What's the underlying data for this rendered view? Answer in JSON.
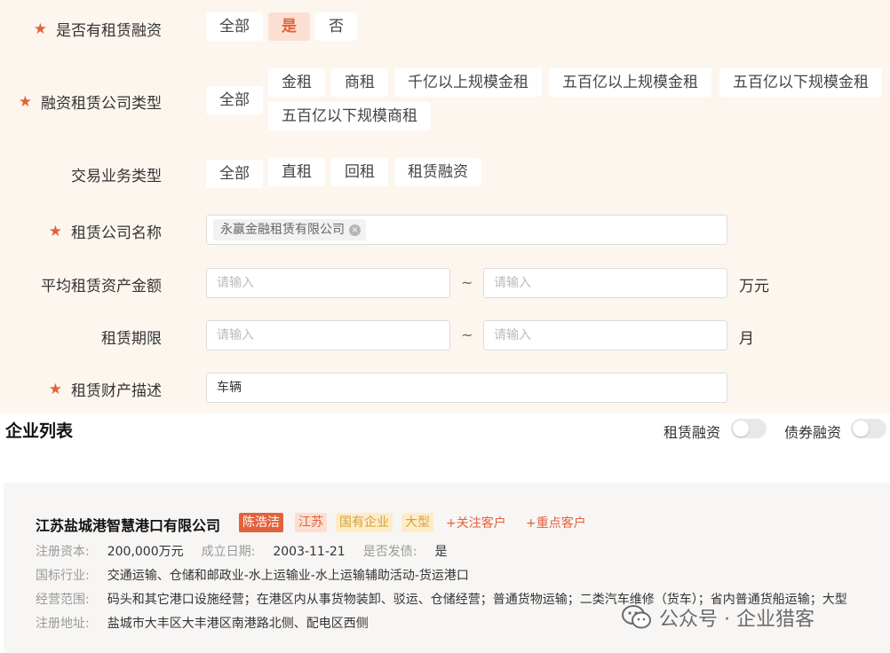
{
  "filters": {
    "financing": {
      "label": "是否有租赁融资",
      "options": [
        "全部",
        "是",
        "否"
      ],
      "selected": "是"
    },
    "company_type": {
      "label": "融资租赁公司类型",
      "all_label": "全部",
      "options": [
        "金租",
        "商租",
        "千亿以上规模金租",
        "五百亿以上规模金租",
        "五百亿以下规模金租",
        "五百亿以下规模商租"
      ]
    },
    "business_type": {
      "label": "交易业务类型",
      "options": [
        "全部",
        "直租",
        "回租",
        "租赁融资"
      ]
    },
    "lessor_name": {
      "label": "租赁公司名称",
      "tag": "永赢金融租赁有限公司",
      "tag_close": "×"
    },
    "avg_assets": {
      "label": "平均租赁资产金额",
      "min_placeholder": "请输入",
      "max_placeholder": "请输入",
      "separator": "~",
      "unit": "万元"
    },
    "lease_term": {
      "label": "租赁期限",
      "min_placeholder": "请输入",
      "max_placeholder": "请输入",
      "separator": "~",
      "unit": "月"
    },
    "asset_desc": {
      "label": "租赁财产描述",
      "value": "车辆"
    }
  },
  "list": {
    "title": "企业列表",
    "toggles": [
      {
        "label": "租赁融资",
        "on": false
      },
      {
        "label": "债券融资",
        "on": false
      }
    ]
  },
  "company": {
    "name": "江苏盐城港智慧港口有限公司",
    "badges": {
      "person": "陈浩洁",
      "province": "江苏",
      "ownership": "国有企业",
      "size": "大型"
    },
    "actions": {
      "follow": "+关注客户",
      "key": "+重点客户"
    },
    "capital_key": "注册资本:",
    "capital_val": "200,000万元",
    "founded_key": "成立日期:",
    "founded_val": "2003-11-21",
    "bond_key": "是否发债:",
    "bond_val": "是",
    "industry_key": "国标行业:",
    "industry_val": "交通运输、仓储和邮政业-水上运输业-水上运输辅助活动-货运港口",
    "scope_key": "经营范围:",
    "scope_val": "码头和其它港口设施经营；在港区内从事货物装卸、驳运、仓储经营；普通货物运输；二类汽车维修（货车）；省内普通货船运输；大型",
    "address_key": "注册地址:",
    "address_val": "盐城市大丰区大丰港区南港路北侧、配电区西侧"
  },
  "watermark": {
    "text": "公众号 · 企业猎客",
    "icon": "wechat-icon"
  },
  "colors": {
    "accent": "#e2623d",
    "panel_bg": "#fdf6ef",
    "chip_active_bg": "#fbdfd2"
  }
}
